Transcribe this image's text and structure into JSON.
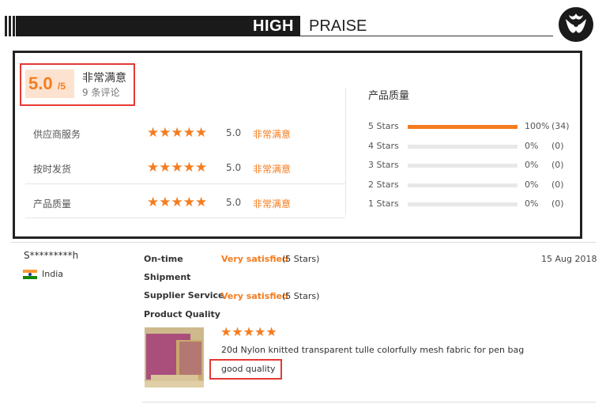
{
  "banner": {
    "title_bold": "HIGH",
    "title_light": "PRAISE"
  },
  "summary": {
    "score": "5.0",
    "score_max": "/5",
    "rating_text": "非常满意",
    "review_count": "9 条评论",
    "rows": [
      {
        "label": "供应商服务",
        "stars": "★★★★★",
        "score": "5.0",
        "satisfaction": "非常满意"
      },
      {
        "label": "按时发货",
        "stars": "★★★★★",
        "score": "5.0",
        "satisfaction": "非常满意"
      },
      {
        "label": "产品质量",
        "stars": "★★★★★",
        "score": "5.0",
        "satisfaction": "非常满意"
      }
    ]
  },
  "distribution": {
    "title": "产品质量",
    "rows": [
      {
        "label": "5 Stars",
        "fraction": 1.0,
        "percent": "100%",
        "count": "(34)"
      },
      {
        "label": "4 Stars",
        "fraction": 0.0,
        "percent": "0%",
        "count": "(0)"
      },
      {
        "label": "3 Stars",
        "fraction": 0.0,
        "percent": "0%",
        "count": "(0)"
      },
      {
        "label": "2 Stars",
        "fraction": 0.0,
        "percent": "0%",
        "count": "(0)"
      },
      {
        "label": "1 Stars",
        "fraction": 0.0,
        "percent": "0%",
        "count": "(0)"
      }
    ]
  },
  "review": {
    "reviewer": "S*********h",
    "country": "India",
    "date": "15 Aug 2018",
    "ratings": [
      {
        "label": "On-time",
        "satisfaction": "Very satisfied",
        "stars_text": "(5 Stars)"
      },
      {
        "label": "Shipment",
        "satisfaction": "",
        "stars_text": ""
      },
      {
        "label": "Supplier Service",
        "satisfaction": "Very satisfied",
        "stars_text": "(5 Stars)"
      },
      {
        "label": "Product Quality",
        "satisfaction": "",
        "stars_text": ""
      }
    ],
    "product_stars": "★★★★★",
    "product_name": "20d Nylon knitted transparent tulle colorfully mesh fabric for pen bag",
    "comment": "good quality"
  },
  "colors": {
    "accent": "#f57c1f",
    "highlight_border": "#e53935",
    "banner": "#1a1a1a"
  },
  "icons": {
    "logo": "brand-logo",
    "flag": "india-flag-icon",
    "star": "star-icon"
  }
}
